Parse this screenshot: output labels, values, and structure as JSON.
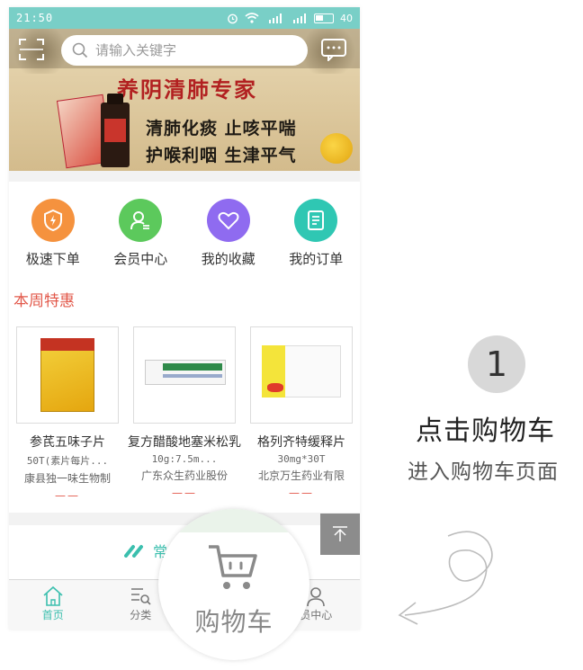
{
  "status_bar": {
    "time": "21:50",
    "battery": "40"
  },
  "search": {
    "placeholder": "请输入关键字"
  },
  "banner": {
    "title": "养阴清肺专家",
    "line1": "清肺化痰  止咳平喘",
    "line2": "护喉利咽  生津平气"
  },
  "quick_actions": [
    {
      "label": "极速下单",
      "icon": "lightning-shield-icon",
      "color": "#f5923e"
    },
    {
      "label": "会员中心",
      "icon": "member-icon",
      "color": "#5cc95c"
    },
    {
      "label": "我的收藏",
      "icon": "heart-icon",
      "color": "#8f6bf0"
    },
    {
      "label": "我的订单",
      "icon": "order-list-icon",
      "color": "#2fc7b3"
    }
  ],
  "section_title": "本周特惠",
  "products": [
    {
      "name": "参芪五味子片",
      "spec": "50T(素片每片...",
      "maker": "康县独一味生物制",
      "price": "——"
    },
    {
      "name": "复方醋酸地塞米松乳",
      "spec": "10g:7.5m...",
      "maker": "广东众生药业股份",
      "price": "——"
    },
    {
      "name": "格列齐特缓释片",
      "spec": "30mg*30T",
      "maker": "北京万生药业有限",
      "price": "——"
    }
  ],
  "common_label": "常",
  "tabs": [
    {
      "label": "首页",
      "icon": "home-icon",
      "active": true
    },
    {
      "label": "分类",
      "icon": "category-icon",
      "active": false
    },
    {
      "label": "",
      "icon": "cart-icon",
      "active": false
    },
    {
      "label": "员中心",
      "icon": "user-icon",
      "active": false
    }
  ],
  "magnifier": {
    "label": "购物车",
    "icon": "cart-icon"
  },
  "step": {
    "number": "1",
    "title": "点击购物车",
    "subtitle": "进入购物车页面"
  },
  "colors": {
    "accent": "#3bbfae",
    "status_bar": "#79cfc7",
    "sale_red": "#e2584a"
  }
}
